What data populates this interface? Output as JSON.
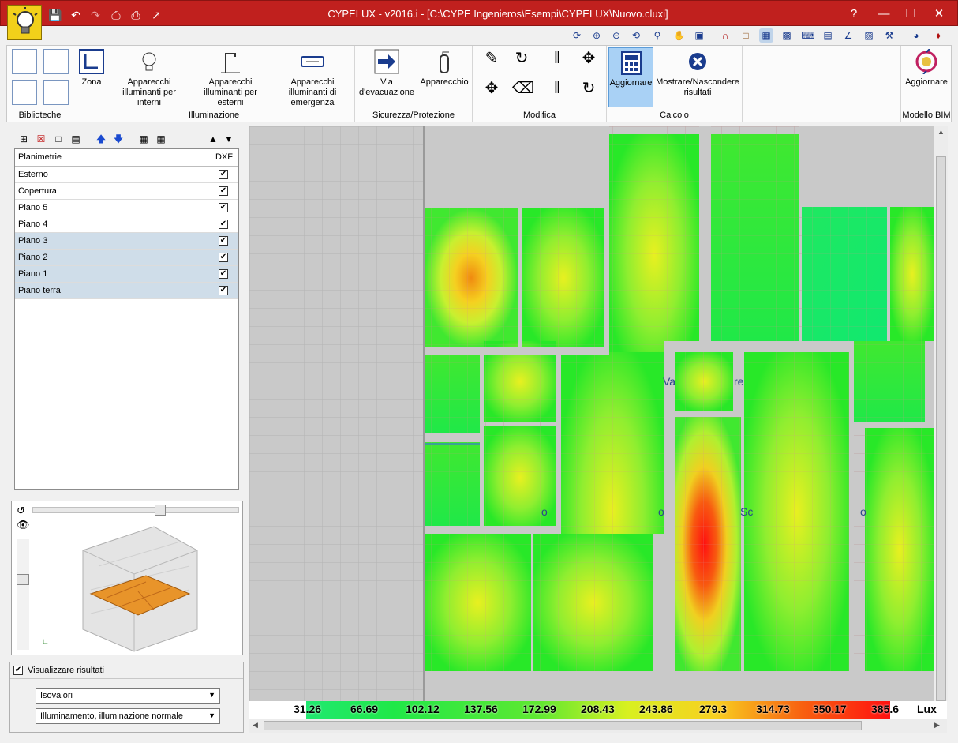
{
  "window": {
    "title": "CYPELUX - v2016.i - [C:\\CYPE Ingenieros\\Esempi\\CYPELUX\\Nuovo.cluxi]",
    "help": "?",
    "minimize": "—",
    "maximize": "☐",
    "close": "✕"
  },
  "ribbon": {
    "groups": [
      {
        "label": "Biblioteche"
      },
      {
        "label": "Illuminazione"
      },
      {
        "label": "Sicurezza/Protezione"
      },
      {
        "label": "Modifica"
      },
      {
        "label": "Calcolo"
      },
      {
        "label": "Modello BIM"
      }
    ],
    "buttons": {
      "zona": "Zona",
      "interni": "Apparecchi illuminanti per interni",
      "esterni": "Apparecchi illuminanti per esterni",
      "emergenza": "Apparecchi illuminanti di emergenza",
      "via": "Via d'evacuazione",
      "apparecchio": "Apparecchio",
      "aggiornare": "Aggiornare",
      "mostrare": "Mostrare/Nascondere risultati",
      "bim": "Aggiornare"
    }
  },
  "plans": {
    "header_name": "Planimetrie",
    "header_dxf": "DXF",
    "rows": [
      {
        "name": "Esterno",
        "checked": true,
        "selected": false
      },
      {
        "name": "Copertura",
        "checked": true,
        "selected": false
      },
      {
        "name": "Piano 5",
        "checked": true,
        "selected": false
      },
      {
        "name": "Piano 4",
        "checked": true,
        "selected": false
      },
      {
        "name": "Piano 3",
        "checked": true,
        "selected": true
      },
      {
        "name": "Piano 2",
        "checked": true,
        "selected": true
      },
      {
        "name": "Piano 1",
        "checked": true,
        "selected": true
      },
      {
        "name": "Piano terra",
        "checked": true,
        "selected": true
      }
    ]
  },
  "results": {
    "show_label": "Visualizzare risultati",
    "show_checked": true,
    "mode": "Isovalori",
    "quantity": "Illuminamento, illuminazione normale"
  },
  "legend": {
    "values": [
      "31.26",
      "66.69",
      "102.12",
      "137.56",
      "172.99",
      "208.43",
      "243.86",
      "279.3",
      "314.73",
      "350.17",
      "385.6"
    ],
    "unit": "Lux"
  },
  "canvas": {
    "labels": [
      "Va",
      "re",
      "o",
      "o",
      "Sc",
      "o"
    ]
  },
  "colors": {
    "titlebar": "#c0201e",
    "selected_row": "#cfdde9",
    "active_button": "#a9d1f5"
  }
}
